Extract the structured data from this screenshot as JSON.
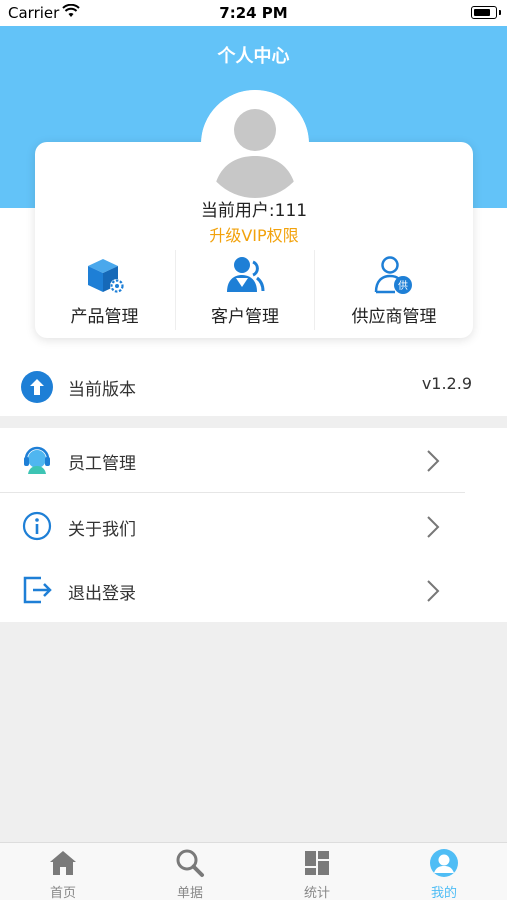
{
  "status_bar": {
    "carrier": "Carrier",
    "time": "7:24 PM"
  },
  "header": {
    "title": "个人中心"
  },
  "profile": {
    "user_text": "当前用户:111",
    "vip_link": "升级VIP权限"
  },
  "quick_actions": [
    {
      "label": "产品管理",
      "icon": "product-box-icon"
    },
    {
      "label": "客户管理",
      "icon": "customers-icon"
    },
    {
      "label": "供应商管理",
      "icon": "supplier-icon"
    }
  ],
  "version": {
    "label": "当前版本",
    "value": "v1.2.9",
    "icon": "upload-arrow-icon"
  },
  "menu": [
    {
      "label": "员工管理",
      "icon": "staff-headset-icon"
    },
    {
      "label": "关于我们",
      "icon": "info-icon"
    },
    {
      "label": "退出登录",
      "icon": "logout-icon"
    }
  ],
  "tabs": [
    {
      "label": "首页",
      "icon": "home-icon"
    },
    {
      "label": "单据",
      "icon": "search-icon"
    },
    {
      "label": "统计",
      "icon": "stats-icon"
    },
    {
      "label": "我的",
      "icon": "profile-icon"
    }
  ],
  "colors": {
    "header": "#63c3f8",
    "accent": "#4fbdf5",
    "vip": "#f2a20c",
    "icon_blue": "#1e7fd6"
  }
}
